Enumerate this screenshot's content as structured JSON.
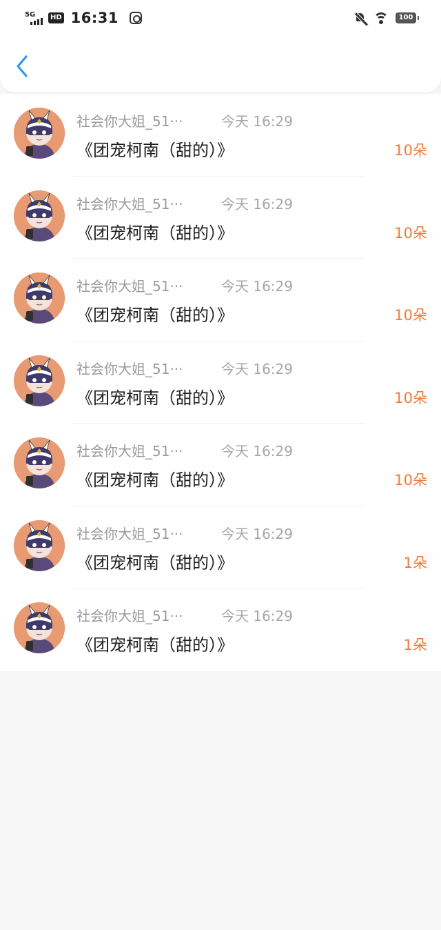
{
  "status_bar": {
    "network": "5G",
    "hd": "HD",
    "time": "16:31",
    "battery": "100",
    "icons": [
      "signal-icon",
      "hd-icon",
      "app-notification-icon",
      "bell-off-icon",
      "wifi-icon",
      "battery-icon"
    ]
  },
  "nav": {
    "back_icon": "chevron-left-icon",
    "accent_color": "#2a9af3"
  },
  "colors": {
    "amount": "#f07a3a",
    "avatar_bg": "#e89a72"
  },
  "items": [
    {
      "name": "社会你大姐_51···",
      "time": "今天  16:29",
      "title": "《团宠柯南（甜的）》",
      "amount": "10朵"
    },
    {
      "name": "社会你大姐_51···",
      "time": "今天  16:29",
      "title": "《团宠柯南（甜的）》",
      "amount": "10朵"
    },
    {
      "name": "社会你大姐_51···",
      "time": "今天  16:29",
      "title": "《团宠柯南（甜的）》",
      "amount": "10朵"
    },
    {
      "name": "社会你大姐_51···",
      "time": "今天  16:29",
      "title": "《团宠柯南（甜的）》",
      "amount": "10朵"
    },
    {
      "name": "社会你大姐_51···",
      "time": "今天  16:29",
      "title": "《团宠柯南（甜的）》",
      "amount": "10朵"
    },
    {
      "name": "社会你大姐_51···",
      "time": "今天  16:29",
      "title": "《团宠柯南（甜的）》",
      "amount": "1朵"
    },
    {
      "name": "社会你大姐_51···",
      "time": "今天  16:29",
      "title": "《团宠柯南（甜的）》",
      "amount": "1朵"
    }
  ]
}
